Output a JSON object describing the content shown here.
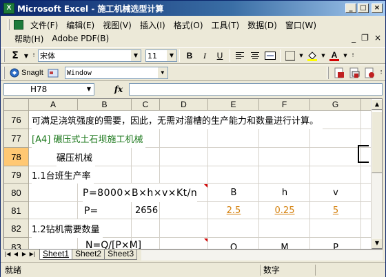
{
  "window": {
    "title": "Microsoft Excel - 施工机械选型计算",
    "minimize": "_",
    "maximize": "□",
    "close": "×"
  },
  "menu": {
    "row1": [
      "文件(F)",
      "编辑(E)",
      "视图(V)",
      "插入(I)",
      "格式(O)",
      "工具(T)",
      "数据(D)",
      "窗口(W)"
    ],
    "row2": [
      "帮助(H)",
      "Adobe PDF(B)"
    ],
    "mdi_min": "_",
    "mdi_restore": "❐",
    "mdi_close": "×"
  },
  "toolbar": {
    "sum_icon": "Σ",
    "font_name": "宋体",
    "font_size": "11",
    "bold": "B",
    "italic": "I",
    "underline": "U",
    "font_color_letter": "A"
  },
  "snagit": {
    "label": "SnagIt",
    "capture_mode": "Window"
  },
  "formula_bar": {
    "name_box": "H78",
    "fx": "fx",
    "formula": ""
  },
  "columns": [
    "A",
    "B",
    "C",
    "D",
    "E",
    "F",
    "G"
  ],
  "rows": [
    {
      "num": "76"
    },
    {
      "num": "77"
    },
    {
      "num": "78"
    },
    {
      "num": "79"
    },
    {
      "num": "80"
    },
    {
      "num": "81"
    },
    {
      "num": "82"
    },
    {
      "num": "83"
    }
  ],
  "cells": {
    "r76": "可满足浇筑强度的需要，因此，无需对溜槽的生产能力和数量进行计算。",
    "r77": "[A4] 碾压式土石坝施工机械",
    "r78": "碾压机械",
    "r79": "1.1台班生产率",
    "r80_formula": "P=8000×B×h×v×Kt/n",
    "r80_E": "B",
    "r80_F": "h",
    "r80_G": "v",
    "r81_label": "P=",
    "r81_C": "2656",
    "r81_E": "2.5",
    "r81_F": "0.25",
    "r81_G": "5",
    "r82": "1.2钻机需要数量",
    "r83_formula": "N=Q/[P×M]",
    "r83_E": "Q",
    "r83_F": "M",
    "r83_G": "P"
  },
  "sheets": [
    "Sheet1",
    "Sheet2",
    "Sheet3"
  ],
  "active_sheet": "Sheet1",
  "status": {
    "ready": "就绪",
    "mode": "数字"
  },
  "colors": {
    "title_bar": "#0a246a",
    "green_text": "#1f7a1f",
    "link": "#d4800c",
    "active_row_header": "#ffc873"
  }
}
